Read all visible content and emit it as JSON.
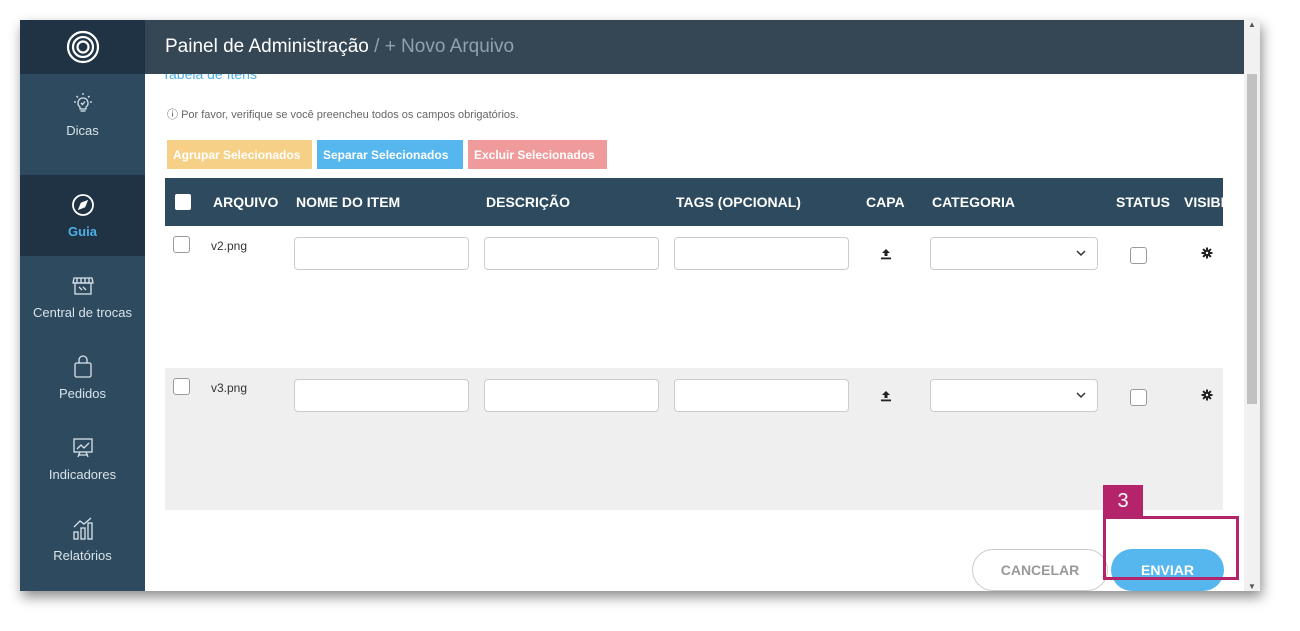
{
  "header": {
    "title": "Painel de Administração",
    "separator": " / ",
    "current": "+ Novo Arquivo"
  },
  "sidebar": {
    "logo": "logo-icon",
    "items": [
      {
        "label": "Dicas",
        "icon": "lightbulb-icon",
        "active": false
      },
      {
        "label": "Guia",
        "icon": "compass-icon",
        "active": true
      },
      {
        "label": "Central de trocas",
        "icon": "store-icon",
        "active": false
      },
      {
        "label": "Pedidos",
        "icon": "shopping-bag-icon",
        "active": false
      },
      {
        "label": "Indicadores",
        "icon": "presentation-chart-icon",
        "active": false
      },
      {
        "label": "Relatórios",
        "icon": "reports-chart-icon",
        "active": false
      }
    ]
  },
  "main": {
    "section_title": "Tabela de Itens",
    "notice": "Por favor, verifique se você preencheu todos os campos obrigatórios.",
    "bulk_actions": {
      "group": "Agrupar Selecionados",
      "split": "Separar Selecionados",
      "delete": "Excluir Selecionados"
    },
    "columns": [
      "ARQUIVO",
      "NOME DO ITEM",
      "DESCRIÇÃO",
      "TAGS (OPCIONAL)",
      "CAPA",
      "CATEGORIA",
      "STATUS",
      "VISIBI"
    ],
    "rows": [
      {
        "file": "v2.png",
        "item_name": "",
        "description": "",
        "tags": "",
        "category": ""
      },
      {
        "file": "v3.png",
        "item_name": "",
        "description": "",
        "tags": "",
        "category": ""
      }
    ],
    "actions": {
      "cancel": "CANCELAR",
      "send": "ENVIAR"
    }
  },
  "annotation": {
    "step": "3"
  },
  "colors": {
    "sidebar": "#2d4a5e",
    "header": "#354654",
    "accent": "#56b6ee",
    "group_button": "#f6d086",
    "delete_button": "#f09b9b",
    "highlight": "#b3246b"
  }
}
